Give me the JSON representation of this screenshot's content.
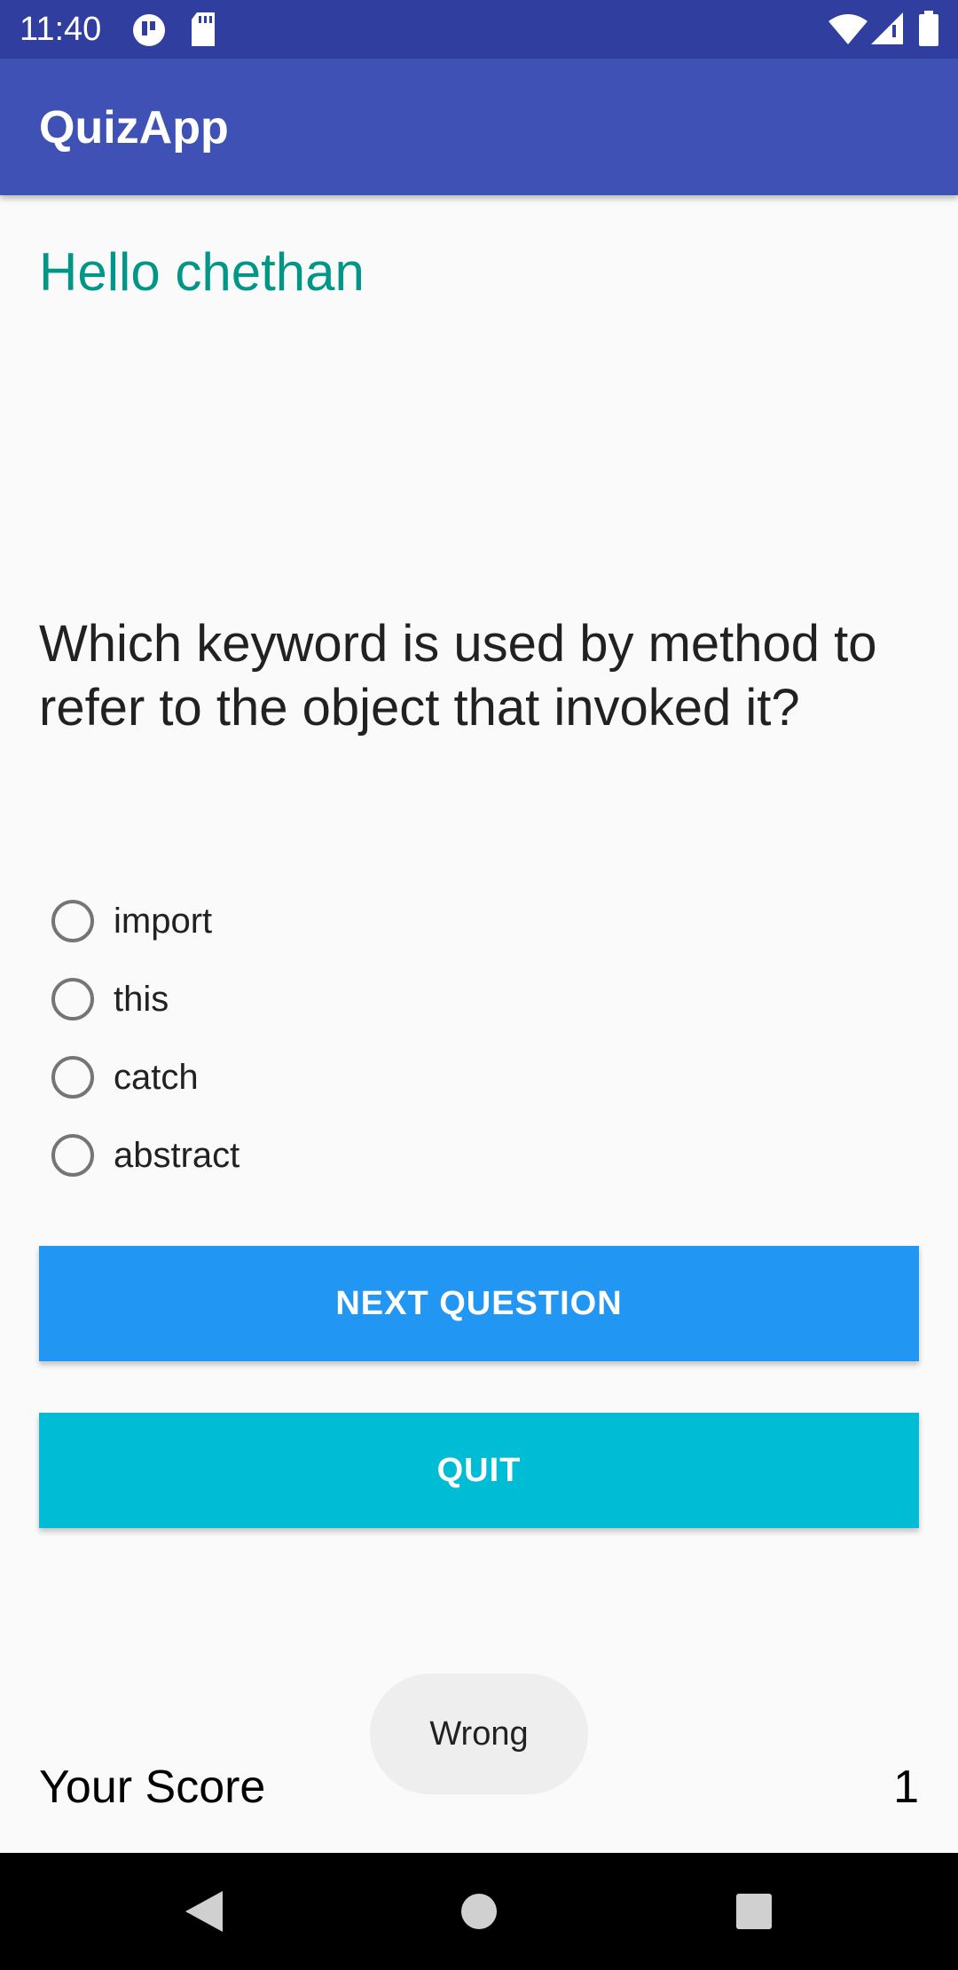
{
  "status_bar": {
    "time": "11:40",
    "icons": [
      "notification-icon",
      "sd-card-icon",
      "wifi-icon",
      "signal-icon",
      "battery-icon"
    ]
  },
  "app_bar": {
    "title": "QuizApp"
  },
  "greeting": "Hello chethan",
  "question": "Which keyword is used by method to refer to the object that invoked it?",
  "options": [
    "import",
    "this",
    "catch",
    "abstract"
  ],
  "buttons": {
    "next": "NEXT QUESTION",
    "quit": "QUIT"
  },
  "score": {
    "label": "Your Score",
    "value": "1"
  },
  "toast": "Wrong",
  "nav_bar": {
    "icons": [
      "back-icon",
      "home-icon",
      "recents-icon"
    ]
  },
  "colors": {
    "status_bar": "#303f9f",
    "app_bar": "#3f51b5",
    "greeting": "#009688",
    "next_button": "#2196f3",
    "quit_button": "#00bcd4"
  }
}
